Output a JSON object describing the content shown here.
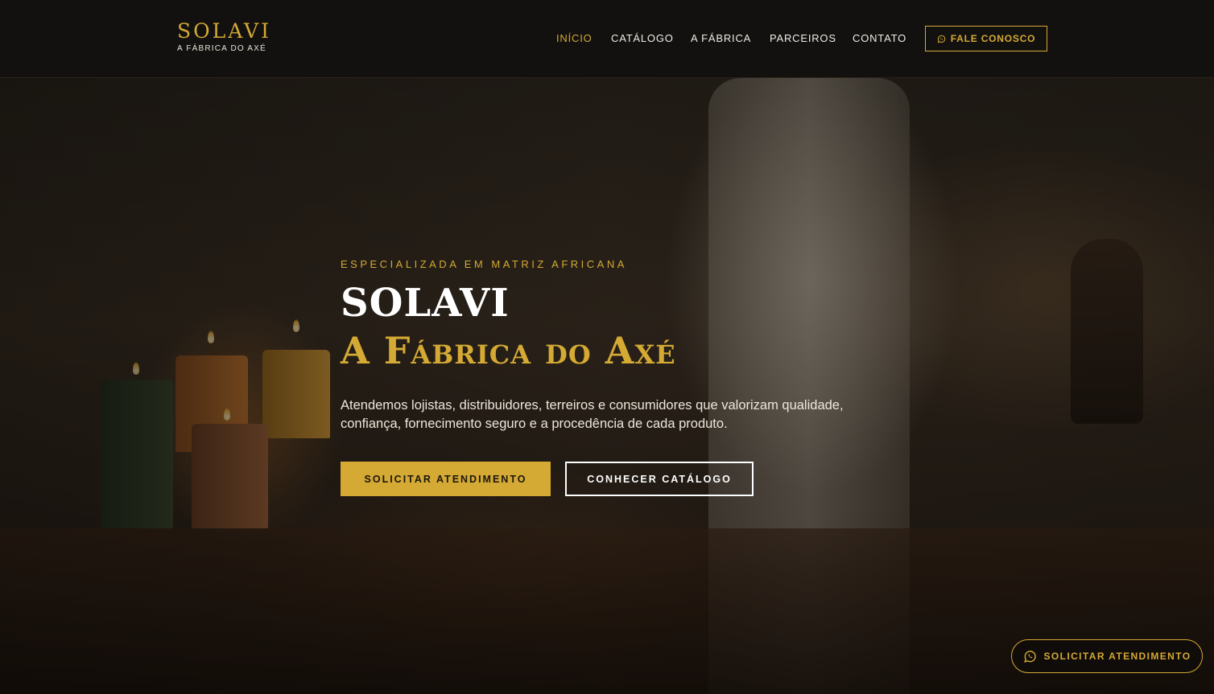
{
  "header": {
    "brand_name": "SOLAVI",
    "brand_tagline": "A FÁBRICA DO AXÉ",
    "nav": [
      {
        "label": "INÍCIO",
        "active": true
      },
      {
        "label": "CATÁLOGO",
        "active": false
      },
      {
        "label": "A FÁBRICA",
        "active": false
      },
      {
        "label": "PARCEIROS",
        "active": false
      },
      {
        "label": "CONTATO",
        "active": false
      }
    ],
    "cta_label": "FALE CONOSCO",
    "cta_icon": "whatsapp-icon"
  },
  "hero": {
    "eyebrow": "ESPECIALIZADA EM MATRIZ AFRICANA",
    "title_line1": "SOLAVI",
    "title_line2": "A Fábrica do Axé",
    "lead_line1": "Atendemos lojistas, distribuidores, terreiros e consumidores que valorizam qualidade,",
    "lead_line2": "confiança, fornecimento seguro e a procedência de cada produto.",
    "primary_button": "SOLICITAR ATENDIMENTO",
    "secondary_button": "CONHECER CATÁLOGO"
  },
  "floating_cta": {
    "label": "SOLICITAR ATENDIMENTO",
    "icon": "whatsapp-icon"
  },
  "colors": {
    "accent": "#d4a934",
    "header_bg": "#121110",
    "text": "#ffffff"
  }
}
